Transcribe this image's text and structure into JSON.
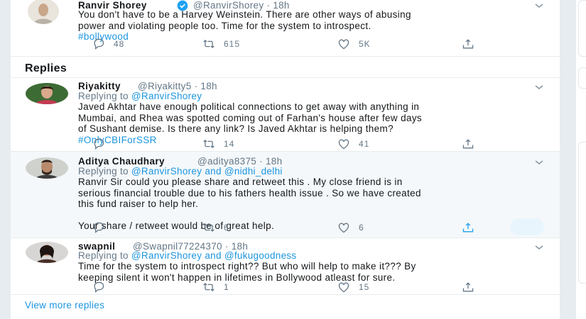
{
  "original_tweet": {
    "name": "Ranvir Shorey",
    "handle_time": "@RanvirShorey · 18h",
    "verified": true,
    "text_lines": [
      "You don't have to be a Harvey Weinstein. There are other ways of abusing",
      "power and violating people too. Time for the system to introspect."
    ],
    "hashtag": "#bollywood",
    "replies": "48",
    "retweets": "615",
    "likes": "5K"
  },
  "replies_header": "Replies",
  "replies": [
    {
      "name": "Riyakitty",
      "handle_time": "@Riyakitty5 · 18h",
      "replying_prefix": "Replying to ",
      "replying_to": "@RanvirShorey",
      "replying_and": "",
      "replying_to2": "",
      "text_lines": [
        "Javed Akhtar have enough political connections to get away with anything in",
        "Mumbai, and Rhea was spotted coming out of Farhan's house after few days",
        "of Sushant demise. Is there any link? Is Javed Akhtar is helping them?"
      ],
      "hashtag": "#OnlyCBIForSSR",
      "replies": "",
      "retweets": "14",
      "likes": "41"
    },
    {
      "name": "Aditya Chaudhary",
      "handle_time": "@aditya8375 · 18h",
      "replying_prefix": "Replying to ",
      "replying_to": "@RanvirShorey",
      "replying_and": " and ",
      "replying_to2": "@nidhi_delhi",
      "text_lines": [
        "Ranvir Sir could you please share and retweet  this . My close friend is in",
        "serious financial trouble due to his fathers health issue  . So we have created",
        "this fund raiser to help her.",
        "",
        "Your share / retweet would be of great help."
      ],
      "hashtag": "",
      "replies": "",
      "retweets": "6",
      "likes": "6"
    },
    {
      "name": "swapnil",
      "handle_time": "@Swapnil77224370 · 18h",
      "replying_prefix": "Replying to ",
      "replying_to": "@RanvirShorey",
      "replying_and": " and ",
      "replying_to2": "@fukugoodness",
      "text_lines": [
        "Time for the system to introspect right?? But who will help to make it??? By",
        "keeping silent it won't happen in lifetimes in Bollywood atleast for sure."
      ],
      "hashtag": "",
      "replies": "",
      "retweets": "1",
      "likes": "15"
    }
  ],
  "view_more": "View more replies",
  "colors": {
    "link": "#1b95e0",
    "muted": "#657786",
    "verified": "#1da1f2",
    "background": "#e6ecf0"
  },
  "icons": [
    "reply-icon",
    "retweet-icon",
    "like-icon",
    "share-icon",
    "caret-down-icon",
    "verified-badge-icon"
  ]
}
